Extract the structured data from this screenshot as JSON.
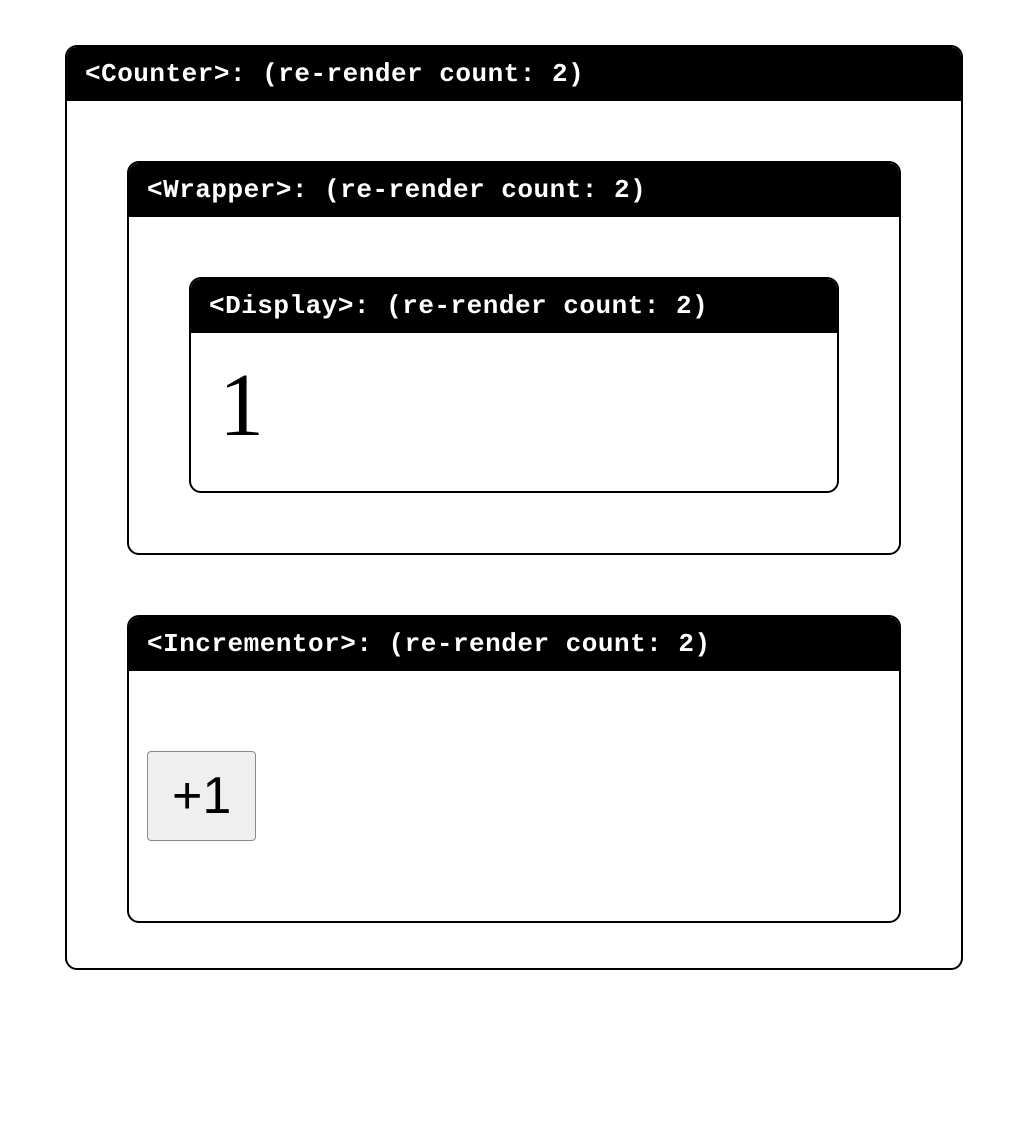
{
  "counter": {
    "header": "<Counter>: (re-render count: 2)"
  },
  "wrapper": {
    "header": "<Wrapper>: (re-render count: 2)"
  },
  "display": {
    "header": "<Display>: (re-render count: 2)",
    "value": "1"
  },
  "incrementor": {
    "header": "<Incrementor>: (re-render count: 2)",
    "button_label": "+1"
  }
}
